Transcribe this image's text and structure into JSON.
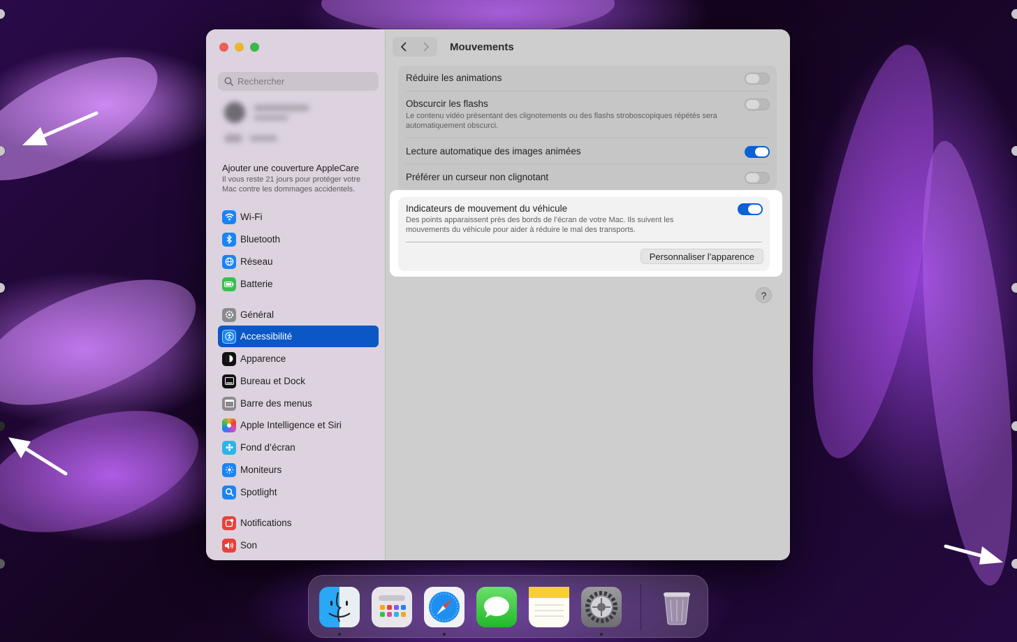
{
  "window": {
    "title": "Mouvements"
  },
  "sidebar": {
    "search_placeholder": "Rechercher",
    "applecare": {
      "title": "Ajouter une couverture AppleCare",
      "description": "Il vous reste 21 jours pour protéger votre Mac contre les dommages accidentels."
    },
    "items": [
      {
        "label": "Wi-Fi",
        "icon": "wifi-icon",
        "color": "#1a84f5"
      },
      {
        "label": "Bluetooth",
        "icon": "bluetooth-icon",
        "color": "#1a84f5"
      },
      {
        "label": "Réseau",
        "icon": "globe-icon",
        "color": "#1a84f5"
      },
      {
        "label": "Batterie",
        "icon": "battery-icon",
        "color": "#36c04e"
      },
      {
        "label": "Général",
        "icon": "gear-icon",
        "color": "#8a8a8e"
      },
      {
        "label": "Accessibilité",
        "icon": "accessibility-icon",
        "color": "#1a84f5",
        "active": true
      },
      {
        "label": "Apparence",
        "icon": "appearance-icon",
        "color": "#111111"
      },
      {
        "label": "Bureau et Dock",
        "icon": "dock-icon",
        "color": "#111111"
      },
      {
        "label": "Barre des menus",
        "icon": "menubar-icon",
        "color": "#8a8a8e"
      },
      {
        "label": "Apple Intelligence et Siri",
        "icon": "siri-icon",
        "color": "#d74fb0"
      },
      {
        "label": "Fond d’écran",
        "icon": "wallpaper-icon",
        "color": "#2db4e8"
      },
      {
        "label": "Moniteurs",
        "icon": "display-icon",
        "color": "#1a84f5"
      },
      {
        "label": "Spotlight",
        "icon": "spotlight-icon",
        "color": "#1a84f5"
      },
      {
        "label": "Notifications",
        "icon": "notifications-icon",
        "color": "#e8413c"
      },
      {
        "label": "Son",
        "icon": "sound-icon",
        "color": "#e8413c"
      }
    ]
  },
  "settings": {
    "reduce_motion": {
      "title": "Réduire les animations",
      "enabled": false
    },
    "dim_flashes": {
      "title": "Obscurcir les flashs",
      "description": "Le contenu vidéo présentant des clignotements ou des flashs stroboscopiques répétés sera automatiquement obscurci.",
      "enabled": false
    },
    "autoplay_animated": {
      "title": "Lecture automatique des images animées",
      "enabled": true
    },
    "non_blinking_cursor": {
      "title": "Préférer un curseur non clignotant",
      "enabled": false
    },
    "vehicle_motion": {
      "title": "Indicateurs de mouvement du véhicule",
      "description": "Des points apparaissent près des bords de l’écran de votre Mac. Ils suivent les mouvements du véhicule pour aider à réduire le mal des transports.",
      "enabled": true,
      "customize_button": "Personnaliser l’apparence"
    },
    "help_label": "?"
  },
  "dock": {
    "apps": [
      "Finder",
      "Launchpad",
      "Safari",
      "Messages",
      "Notes",
      "Réglages Système",
      "Corbeille"
    ]
  },
  "colors": {
    "accent": "#0a57c5",
    "toggle_on": "#0a61d6",
    "wallpaper": "#7b2fd0"
  }
}
